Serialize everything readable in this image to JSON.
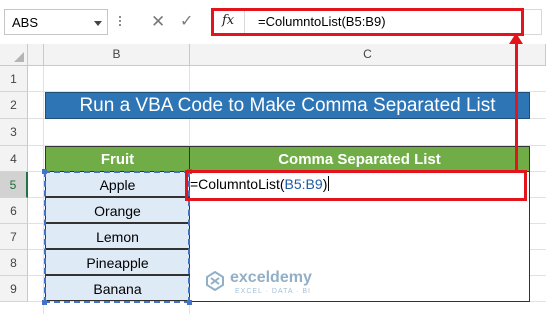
{
  "formula_bar": {
    "name_box": "ABS",
    "cancel_glyph": "✕",
    "enter_glyph": "✓",
    "fx_label": "fx",
    "formula": "=ColumntoList(B5:B9)"
  },
  "grid": {
    "columns": [
      "B",
      "C"
    ],
    "rows": [
      "1",
      "2",
      "3",
      "4",
      "5",
      "6",
      "7",
      "8",
      "9"
    ],
    "active_row": "5"
  },
  "sheet": {
    "title": "Run a VBA Code to Make Comma Separated List",
    "headers": {
      "fruit": "Fruit",
      "list": "Comma Separated List"
    },
    "fruits": [
      "Apple",
      "Orange",
      "Lemon",
      "Pineapple",
      "Banana"
    ],
    "editing_cell": {
      "prefix": "=ColumntoList(",
      "ref": "B5:B9",
      "suffix": ")"
    }
  },
  "watermark": {
    "name": "exceldemy",
    "tagline": "EXCEL · DATA · BI"
  },
  "icons": {
    "formula": "fx-icon",
    "cancel": "cancel-icon",
    "enter": "enter-icon",
    "logo": "exceldemy-logo-icon"
  },
  "colors": {
    "title_fill": "#2e75b6",
    "header_fill": "#70ad47",
    "cell_fill": "#deeaf6",
    "highlight": "#e4141c",
    "selection": "#4472c4"
  }
}
